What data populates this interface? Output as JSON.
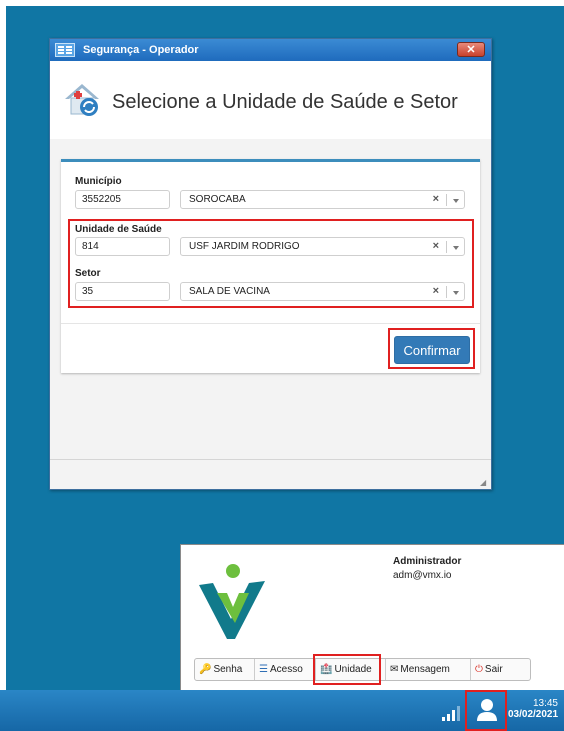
{
  "window": {
    "title": "Segurança - Operador",
    "close_label": "✕",
    "heading": "Selecione a Unidade de Saúde e Setor"
  },
  "form": {
    "municipio": {
      "label": "Município",
      "code": "3552205",
      "name": "SOROCABA"
    },
    "unidade": {
      "label": "Unidade de Saúde",
      "code": "814",
      "name": "USF JARDIM RODRIGO"
    },
    "setor": {
      "label": "Setor",
      "code": "35",
      "name": "SALA DE VACINA"
    },
    "clear_symbol": "×",
    "confirm_label": "Confirmar"
  },
  "user_popup": {
    "name": "Administrador",
    "email": "adm@vmx.io",
    "buttons": {
      "senha": "Senha",
      "acesso": "Acesso",
      "unidade": "Unidade",
      "mensagem": "Mensagem",
      "sair": "Sair"
    }
  },
  "taskbar": {
    "time": "13:45",
    "date": "03/02/2021"
  },
  "colors": {
    "desktop": "#1076a4",
    "accent": "#337ab7",
    "highlight": "#e02020",
    "logo_green": "#6dbf3e",
    "logo_teal": "#117a8b"
  }
}
